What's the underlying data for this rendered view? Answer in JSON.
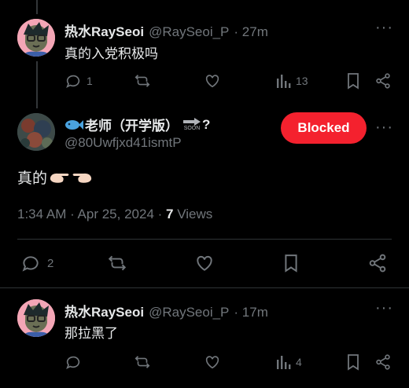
{
  "post1": {
    "name": "热水RaySeoi",
    "handle": "@RaySeoi_P",
    "time": "· 27m",
    "text": "真的入党积极吗",
    "replies": "1",
    "views": "13"
  },
  "post2": {
    "name": "老师（开学版）",
    "name_suffix": "?",
    "soon_label": "SOON",
    "handle": "@80Uwfjxd41ismtP",
    "text": "真的",
    "blocked_label": "Blocked",
    "timestamp": "1:34 AM · Apr 25, 2024 · ",
    "views_count": "7",
    "views_label": " Views",
    "replies": "2"
  },
  "post3": {
    "name": "热水RaySeoi",
    "handle": "@RaySeoi_P",
    "time": "· 17m",
    "text": "那拉黑了",
    "views": "4"
  },
  "icons": {
    "reply": "reply-icon",
    "retweet": "retweet-icon",
    "like": "heart-icon",
    "views": "views-icon",
    "bookmark": "bookmark-icon",
    "share": "share-icon",
    "more": "more-icon"
  },
  "colors": {
    "background": "#000000",
    "text": "#e7e9ea",
    "secondary": "#71767b",
    "blocked": "#f4212e"
  }
}
